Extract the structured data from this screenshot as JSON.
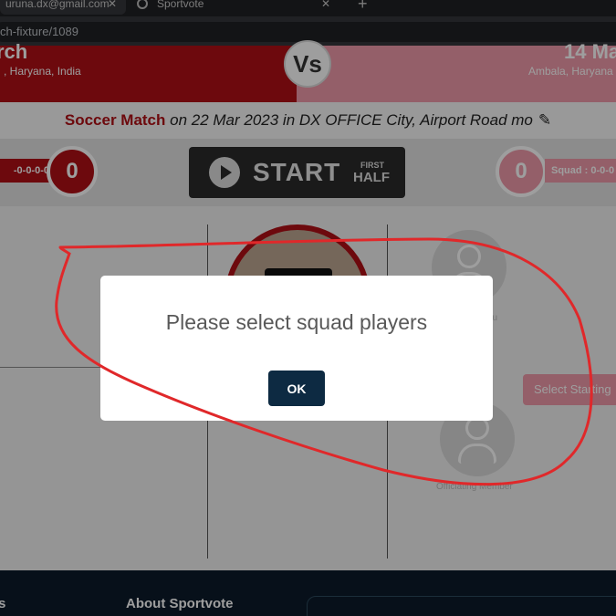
{
  "browser": {
    "tab1_title": "uruna.dx@gmail.com",
    "tab2_title": "Sportvote",
    "tab_close_symbol": "✕",
    "new_tab_symbol": "+",
    "address": "ch-fixture/1089"
  },
  "match": {
    "team_left": {
      "name": "rch",
      "location": ", Haryana, India",
      "score": "0",
      "squad": "-0-0-0-0"
    },
    "team_right": {
      "name": "14 Ma",
      "location": "Ambala, Haryana",
      "score": "0",
      "squad": "Squad : 0-0-0"
    },
    "vs_label": "Vs",
    "match_type": "Soccer Match",
    "match_details": " on 22 Mar 2023 in DX OFFICE City, Airport Road mo",
    "edit_icon": "✎",
    "start_button": {
      "label": "START",
      "half_top": "FIRST",
      "half_main": "HALF"
    },
    "role_label_1": "nu",
    "role_label_2": "Officiating Member",
    "select_starting_label": "Select Starting"
  },
  "footer": {
    "left_heading": "s",
    "about_heading": "About Sportvote"
  },
  "modal": {
    "message": "Please select squad players",
    "ok_label": "OK"
  },
  "colors": {
    "team_left": "#b01016",
    "team_right": "#ef9aaa",
    "modal_button": "#0d2a42",
    "annotation": "#e0282a"
  }
}
